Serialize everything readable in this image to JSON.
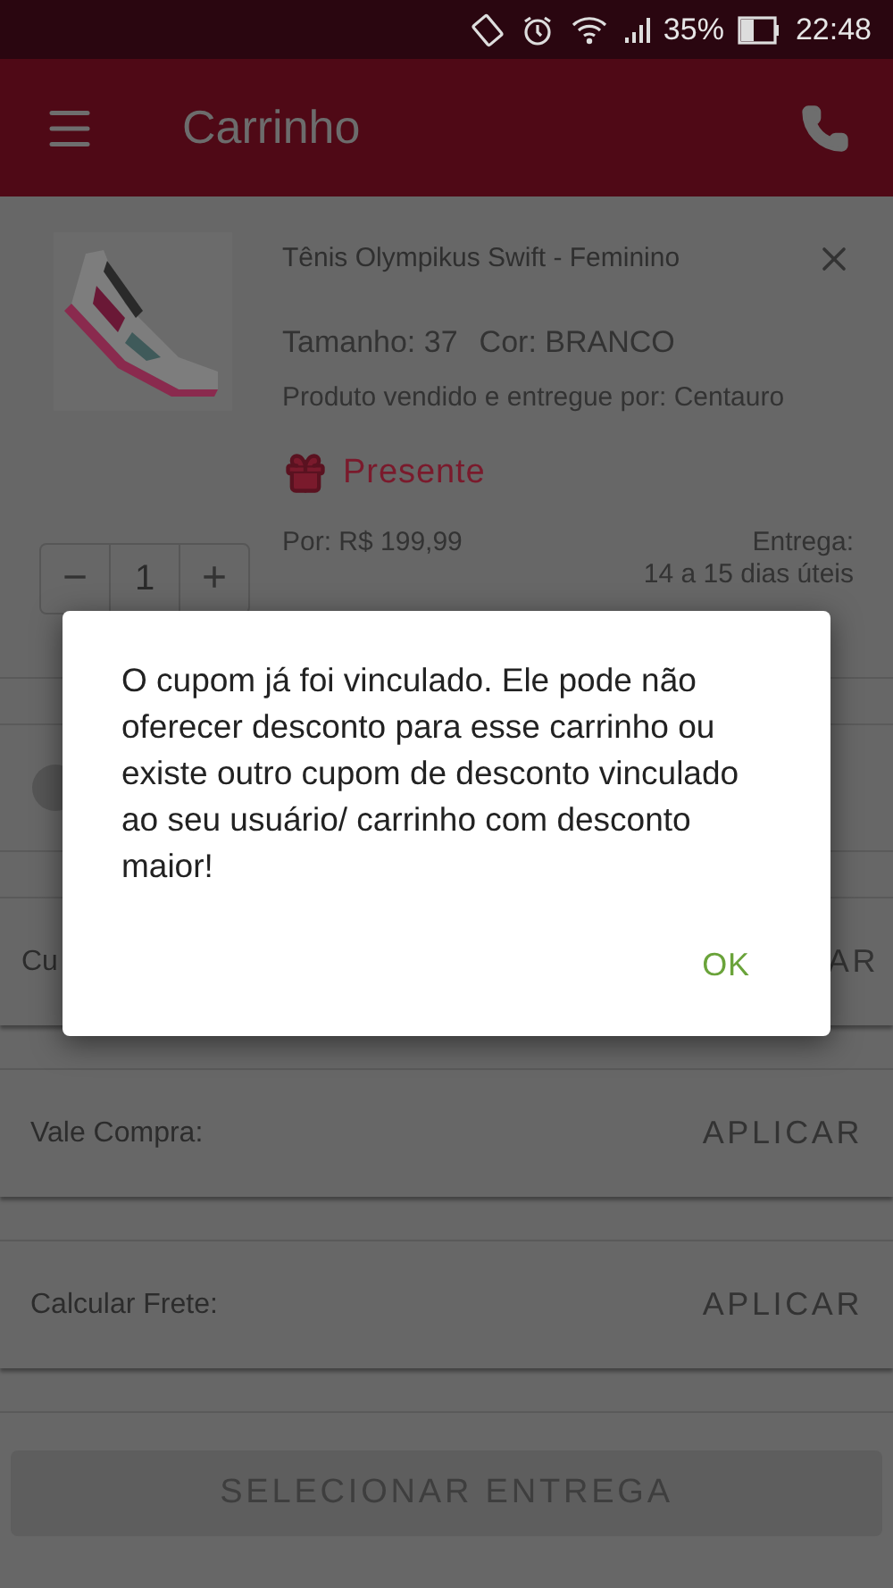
{
  "status_bar": {
    "battery": "35%",
    "time": "22:48"
  },
  "app_bar": {
    "title": "Carrinho"
  },
  "product": {
    "name": "Tênis Olympikus Swift - Feminino",
    "size": "Tamanho: 37",
    "colour_label": "Cor: BRANCO",
    "seller": "Produto vendido e entregue por: Centauro",
    "gift": "Presente",
    "quantity": "1",
    "minus": "−",
    "plus": "+",
    "price": "Por: R$ 199,99",
    "delivery_label": "Entrega:",
    "delivery_time": "14 a 15 dias úteis"
  },
  "rows": [
    {
      "label": "Cu",
      "action": "AR"
    },
    {
      "label": "Vale Compra:",
      "action": "APLICAR"
    },
    {
      "label": "Calcular Frete:",
      "action": "APLICAR"
    }
  ],
  "main_button": "SELECIONAR ENTREGA",
  "dialog": {
    "message": "O cupom já foi vinculado. Ele pode não oferecer desconto para esse carrinho ou existe outro cupom de desconto vinculado ao seu usuário/ carrinho com desconto maior!",
    "button": "OK"
  }
}
